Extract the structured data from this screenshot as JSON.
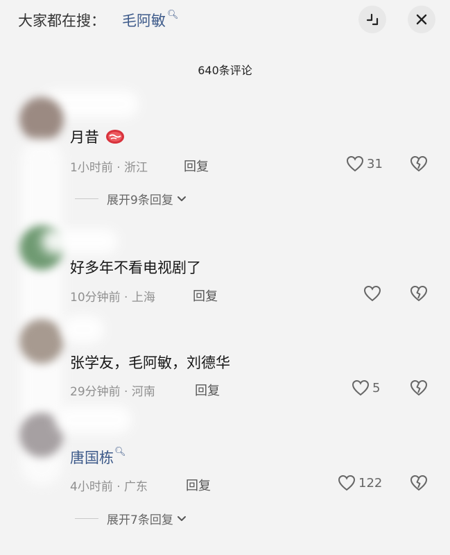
{
  "header": {
    "search_prefix": "大家都在搜：",
    "search_term": "毛阿敏",
    "search_icon": "search-icon",
    "expand_icon": "collapse-corner-icon",
    "close_icon": "close-icon"
  },
  "comment_count": "640条评论",
  "comments": [
    {
      "text": "月昔",
      "emoji": "steak-emoji",
      "time_location": "1小时前 · 浙江",
      "reply_label": "回复",
      "likes": "31",
      "expand_label": "展开9条回复"
    },
    {
      "text": "好多年不看电视剧了",
      "time_location": "10分钟前 · 上海",
      "reply_label": "回复",
      "likes": ""
    },
    {
      "text": "张学友，毛阿敏，刘德华",
      "time_location": "29分钟前 · 河南",
      "reply_label": "回复",
      "likes": "5"
    },
    {
      "text": "唐国栋",
      "time_location": "4小时前 · 广东",
      "reply_label": "回复",
      "likes": "122",
      "expand_label": "展开7条回复"
    }
  ],
  "colors": {
    "background": "#f3f3f3",
    "link_blue": "#3d5a8a",
    "meta_gray": "#8f8f8f"
  }
}
